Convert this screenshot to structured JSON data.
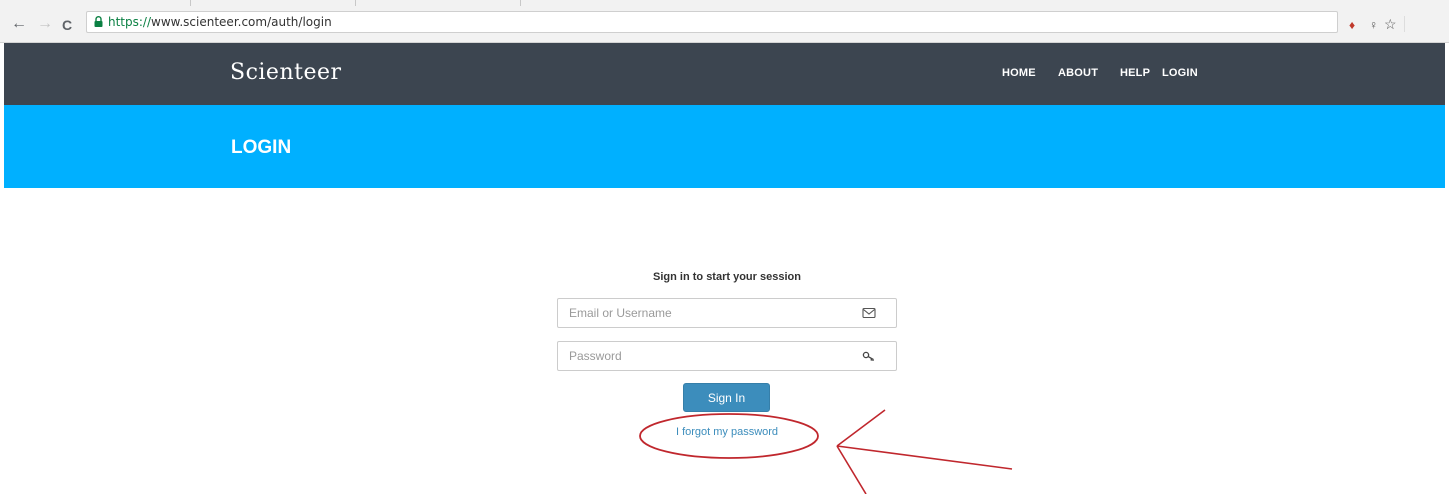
{
  "browser": {
    "url_scheme": "https://",
    "url_rest": "www.scienteer.com/auth/login",
    "back_glyph": "←",
    "forward_glyph": "→",
    "reload_glyph": "C",
    "ext_glyph_1": "♦",
    "ext_glyph_2": "♀",
    "star_glyph": "☆",
    "icons": [
      "back-arrow-icon",
      "forward-arrow-icon",
      "reload-icon",
      "lock-icon",
      "extension-icon",
      "bookmark-star-icon"
    ]
  },
  "header": {
    "brand": "Scienteer",
    "nav": [
      {
        "label": "HOME"
      },
      {
        "label": "ABOUT"
      },
      {
        "label": "HELP"
      },
      {
        "label": "LOGIN"
      }
    ]
  },
  "page": {
    "title": "LOGIN"
  },
  "login": {
    "session_message": "Sign in to start your session",
    "email_placeholder": "Email or Username",
    "email_value": "",
    "email_icon": "envelope-icon",
    "password_placeholder": "Password",
    "password_value": "",
    "password_icon": "key-icon",
    "signin_label": "Sign In",
    "forgot_label": "I forgot my password"
  },
  "colors": {
    "header_bg": "#3c4550",
    "title_band_bg": "#00b0ff",
    "button_bg": "#3c8dbc",
    "link": "#3c8dbc",
    "annotation": "#c0272d"
  }
}
